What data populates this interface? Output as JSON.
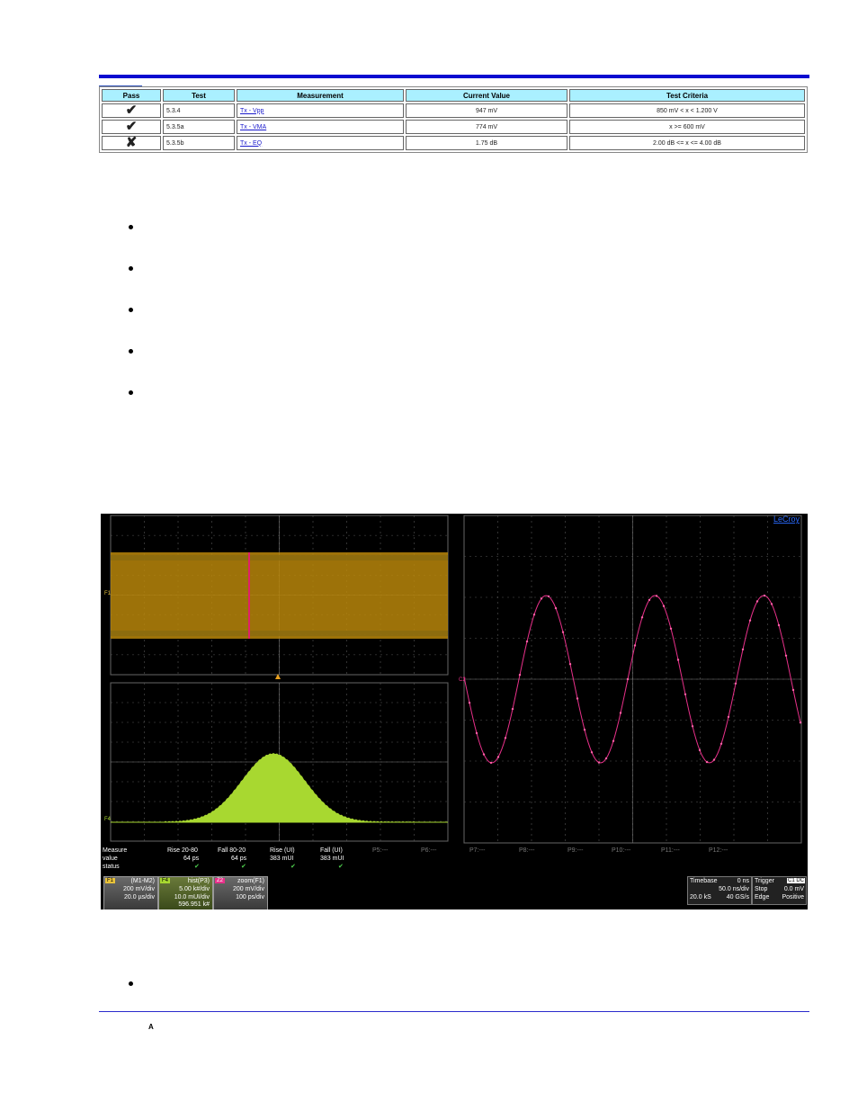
{
  "results_table": {
    "headers": [
      "Pass",
      "Test",
      "Measurement",
      "Current Value",
      "Test Criteria"
    ],
    "rows": [
      {
        "pass": "✔",
        "test": "5.3.4",
        "measurement": "Tx - Vpp",
        "value": "947 mV",
        "criteria": "850 mV < x < 1.200 V",
        "status": "pass"
      },
      {
        "pass": "✔",
        "test": "5.3.5a",
        "measurement": "Tx - VMA",
        "value": "774 mV",
        "criteria": "x >= 600 mV",
        "status": "pass"
      },
      {
        "pass": "✘",
        "test": "5.3.5b",
        "measurement": "Tx - EQ",
        "value": "1.75 dB",
        "criteria": "2.00 dB <= x <= 4.00 dB",
        "status": "fail"
      }
    ],
    "colors": {
      "header_bg": "#aaf0ff",
      "pass": "#2a9a1a",
      "fail": "#dd1a1a"
    }
  },
  "scope": {
    "logo": "LeCroy",
    "markers": {
      "f1": "F1",
      "f4": "F4",
      "c2": "C2"
    },
    "measure": {
      "label": "Measure",
      "value_label": "value",
      "status_label": "status",
      "params": [
        {
          "name": "Rise 20-80",
          "value": "64 ps",
          "status": "✔"
        },
        {
          "name": "Fall 80-20",
          "value": "64 ps",
          "status": "✔"
        },
        {
          "name": "Rise (UI)",
          "value": "383 mUI",
          "status": "✔"
        },
        {
          "name": "Fall (UI)",
          "value": "383 mUI",
          "status": "✔"
        },
        {
          "name": "P5:---"
        },
        {
          "name": "P6:---"
        },
        {
          "name": "P7:---"
        },
        {
          "name": "P8:---"
        },
        {
          "name": "P9:---"
        },
        {
          "name": "P10:---"
        },
        {
          "name": "P11:---"
        },
        {
          "name": "P12:---"
        }
      ]
    },
    "traces": [
      {
        "tag": "F1",
        "title": "(M1-M2)",
        "l1": "200 mV/div",
        "l2": "20.0 µs/div",
        "l3": "",
        "color": "#e8c23a"
      },
      {
        "tag": "F4",
        "title": "hist(P3)",
        "l1": "5.00 k#/div",
        "l2": "10.0 mUI/div",
        "l3": "596.951 k#",
        "color": "#a8d830"
      },
      {
        "tag": "Z2",
        "title": "zoom(F1)",
        "l1": "200 mV/div",
        "l2": "100 ps/div",
        "l3": "",
        "color": "#e8308a"
      }
    ],
    "timebase": {
      "label": "Timebase",
      "delay": "0 ns",
      "tdiv": "50.0 ns/div",
      "samples": "20.0 kS",
      "rate": "40 GS/s"
    },
    "trigger": {
      "label": "Trigger",
      "source": "C1 DC",
      "mode": "Stop",
      "level": "0.0 mV",
      "type": "Edge",
      "slope": "Positive"
    }
  },
  "footer": {
    "mark": "A"
  }
}
